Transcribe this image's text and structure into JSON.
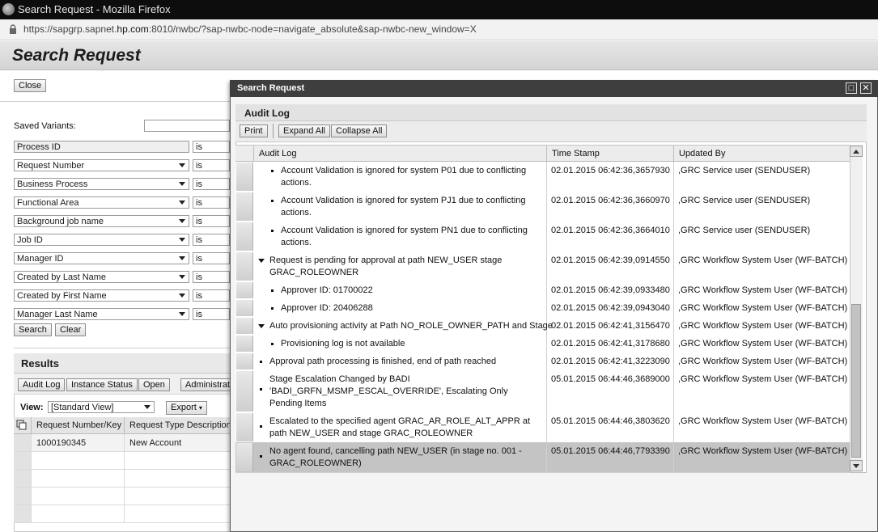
{
  "browser": {
    "window_title": "Search Request - Mozilla Firefox",
    "url_prefix": "https://sapgrp.sapnet.",
    "url_host": "hp.com",
    "url_rest": ":8010/nwbc/?sap-nwbc-node=navigate_absolute&sap-nwbc-new_window=X"
  },
  "page": {
    "title": "Search Request",
    "close_label": "Close"
  },
  "search_form": {
    "saved_variants_label": "Saved Variants:",
    "fields": [
      {
        "label": "Process ID",
        "op": "is"
      },
      {
        "label": "Request Number",
        "op": "is"
      },
      {
        "label": "Business  Process",
        "op": "is"
      },
      {
        "label": "Functional Area",
        "op": "is"
      },
      {
        "label": "Background job name",
        "op": "is"
      },
      {
        "label": "Job ID",
        "op": "is"
      },
      {
        "label": "Manager ID",
        "op": "is"
      },
      {
        "label": "Created by Last Name",
        "op": "is"
      },
      {
        "label": "Created by  First Name",
        "op": "is"
      },
      {
        "label": "Manager Last Name",
        "op": "is"
      }
    ],
    "search_label": "Search",
    "clear_label": "Clear"
  },
  "results": {
    "title": "Results",
    "toolbar": {
      "audit_log": "Audit Log",
      "instance_status": "Instance Status",
      "open": "Open",
      "administrator": "Administrat"
    },
    "view_label": "View:",
    "view_value": "[Standard View]",
    "export_label": "Export",
    "columns": [
      "Request Number/Key",
      "Request Type Description"
    ],
    "rows": [
      {
        "request_number": "1000190345",
        "request_type": "New Account"
      }
    ]
  },
  "popup": {
    "title": "Search Request",
    "panel_title": "Audit Log",
    "print_label": "Print",
    "expand_all_label": "Expand All",
    "collapse_all_label": "Collapse All",
    "columns": {
      "audit_log": "Audit Log",
      "time_stamp": "Time Stamp",
      "updated_by": "Updated By"
    },
    "rows": [
      {
        "text": "Account Validation is ignored for system P01 due to conflicting actions.",
        "ts": "02.01.2015 06:42:36,3657930",
        "by": ",GRC Service user (SENDUSER)"
      },
      {
        "text": "Account Validation is ignored for system PJ1 due to conflicting actions.",
        "ts": "02.01.2015 06:42:36,3660970",
        "by": ",GRC Service user (SENDUSER)"
      },
      {
        "text": "Account Validation is ignored for system PN1 due to conflicting actions.",
        "ts": "02.01.2015 06:42:36,3664010",
        "by": ",GRC Service user (SENDUSER)"
      },
      {
        "text": "Request is pending for approval at path NEW_USER stage GRAC_ROLEOWNER",
        "ts": "02.01.2015 06:42:39,0914550",
        "by": ",GRC Workflow System User (WF-BATCH)"
      },
      {
        "text": "Approver ID: 01700022",
        "ts": "02.01.2015 06:42:39,0933480",
        "by": ",GRC Workflow System User (WF-BATCH)"
      },
      {
        "text": "Approver ID: 20406288",
        "ts": "02.01.2015 06:42:39,0943040",
        "by": ",GRC Workflow System User (WF-BATCH)"
      },
      {
        "text": "Auto provisioning activity at Path NO_ROLE_OWNER_PATH and Stage",
        "ts": "02.01.2015 06:42:41,3156470",
        "by": ",GRC Workflow System User (WF-BATCH)"
      },
      {
        "text": "Provisioning log is not available",
        "ts": "02.01.2015 06:42:41,3178680",
        "by": ",GRC Workflow System User (WF-BATCH)"
      },
      {
        "text": "Approval path processing is finished, end of path reached",
        "ts": "02.01.2015 06:42:41,3223090",
        "by": ",GRC Workflow System User (WF-BATCH)"
      },
      {
        "text": "Stage Escalation Changed by BADI 'BADI_GRFN_MSMP_ESCAL_OVERRIDE', Escalating Only Pending Items",
        "ts": "05.01.2015 06:44:46,3689000",
        "by": ",GRC Workflow System User (WF-BATCH)"
      },
      {
        "text": "Escalated to the specified agent GRAC_AR_ROLE_ALT_APPR at path NEW_USER and stage GRAC_ROLEOWNER",
        "ts": "05.01.2015 06:44:46,3803620",
        "by": ",GRC Workflow System User (WF-BATCH)"
      },
      {
        "text": "No agent found, cancelling path NEW_USER (in stage no. 001 - GRAC_ROLEOWNER)",
        "ts": "05.01.2015 06:44:46,7793390",
        "by": ",GRC Workflow System User (WF-BATCH)"
      }
    ]
  }
}
